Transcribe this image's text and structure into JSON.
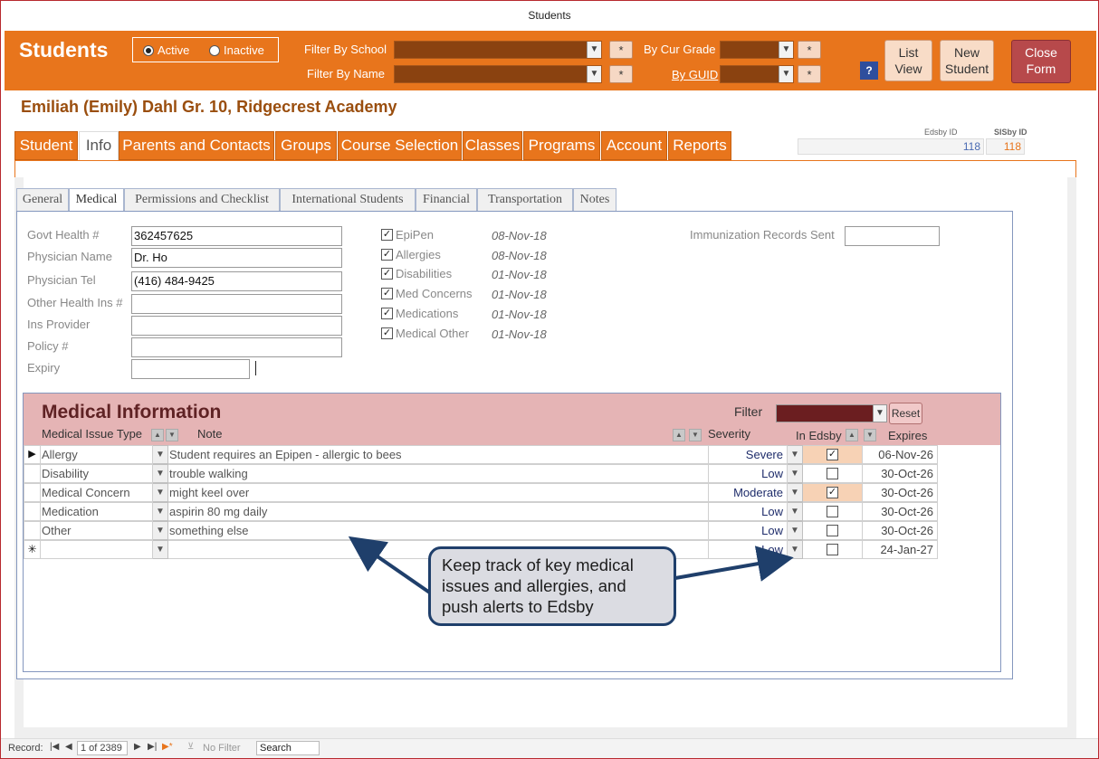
{
  "window": {
    "title": "Students"
  },
  "header": {
    "app_title": "Students",
    "status_active": "Active",
    "status_inactive": "Inactive",
    "filter_school_label": "Filter By School",
    "filter_name_label": "Filter By Name",
    "cur_grade_label": "By Cur Grade",
    "guid_label": "By GUID",
    "star": "*",
    "help": "?",
    "list_view": [
      "List",
      "View"
    ],
    "new_student": [
      "New",
      "Student"
    ],
    "close_form": [
      "Close",
      "Form"
    ]
  },
  "student": {
    "name": "Emiliah (Emily)  Dahl  Gr. 10, Ridgecrest Academy"
  },
  "ids": {
    "edsby_label": "Edsby ID",
    "edsby_value": "118",
    "sisby_label": "SISby ID",
    "sisby_value": "118"
  },
  "main_tabs": [
    {
      "label": "Student"
    },
    {
      "label": "Info"
    },
    {
      "label": "Parents and Contacts"
    },
    {
      "label": "Groups"
    },
    {
      "label": "Course Selection"
    },
    {
      "label": "Classes"
    },
    {
      "label": "Programs"
    },
    {
      "label": "Account"
    },
    {
      "label": "Reports"
    }
  ],
  "sub_tabs": [
    {
      "label": "General"
    },
    {
      "label": "Medical"
    },
    {
      "label": "Permissions and Checklist"
    },
    {
      "label": "International Students"
    },
    {
      "label": "Financial"
    },
    {
      "label": "Transportation"
    },
    {
      "label": "Notes"
    }
  ],
  "fields": {
    "govt_health_label": "Govt Health #",
    "govt_health_value": "362457625",
    "physician_label": "Physician Name",
    "physician_value": "Dr. Ho",
    "physician_tel_label": "Physician Tel",
    "physician_tel_value": "(416) 484-9425",
    "other_ins_label": "Other Health Ins #",
    "other_ins_value": "",
    "ins_provider_label": "Ins Provider",
    "ins_provider_value": "",
    "policy_label": "Policy #",
    "policy_value": "",
    "expiry_label": "Expiry",
    "expiry_value": "",
    "immunization_label": "Immunization Records Sent",
    "immunization_value": ""
  },
  "checklist": [
    {
      "label": "EpiPen",
      "date": "08-Nov-18",
      "checked": "✓"
    },
    {
      "label": "Allergies",
      "date": "08-Nov-18",
      "checked": "✓"
    },
    {
      "label": "Disabilities",
      "date": "01-Nov-18",
      "checked": "✓"
    },
    {
      "label": "Med Concerns",
      "date": "01-Nov-18",
      "checked": "✓"
    },
    {
      "label": "Medications",
      "date": "01-Nov-18",
      "checked": "✓"
    },
    {
      "label": "Medical Other",
      "date": "01-Nov-18",
      "checked": "✓"
    }
  ],
  "medical": {
    "title": "Medical Information",
    "filter_label": "Filter",
    "reset_label": "Reset",
    "col_issue": "Medical Issue Type",
    "col_note": "Note",
    "col_severity": "Severity",
    "col_inedsby": "In Edsby",
    "col_expires": "Expires",
    "rows": [
      {
        "sel": "▶",
        "type": "Allergy",
        "note": "Student requires an Epipen - allergic to bees",
        "severity": "Severe",
        "inedsby": "✓",
        "expires": "06-Nov-26"
      },
      {
        "sel": "",
        "type": "Disability",
        "note": "trouble walking",
        "severity": "Low",
        "inedsby": "",
        "expires": "30-Oct-26"
      },
      {
        "sel": "",
        "type": "Medical Concern",
        "note": "might keel over",
        "severity": "Moderate",
        "inedsby": "✓",
        "expires": "30-Oct-26"
      },
      {
        "sel": "",
        "type": "Medication",
        "note": "aspirin 80 mg daily",
        "severity": "Low",
        "inedsby": "",
        "expires": "30-Oct-26"
      },
      {
        "sel": "",
        "type": "Other",
        "note": "something else",
        "severity": "Low",
        "inedsby": "",
        "expires": "30-Oct-26"
      },
      {
        "sel": "✳",
        "type": "",
        "note": "",
        "severity": "Low",
        "inedsby": "",
        "expires": "24-Jan-27"
      }
    ]
  },
  "callout": {
    "text": "Keep track of key medical issues and allergies, and push alerts to Edsby"
  },
  "record_nav": {
    "record_label": "Record:",
    "position": "1 of 2389",
    "no_filter": "No Filter",
    "search": "Search"
  },
  "colors": {
    "accent": "#e8751c",
    "medical_header": "#e5b4b5",
    "close_button": "#b7494b"
  }
}
